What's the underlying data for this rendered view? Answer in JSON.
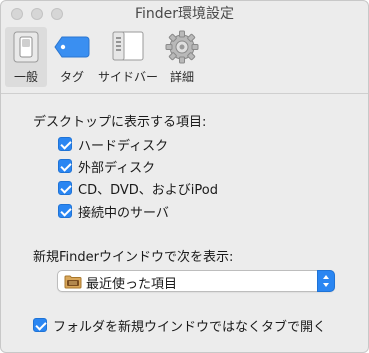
{
  "window": {
    "title": "Finder環境設定"
  },
  "toolbar": {
    "tabs": [
      {
        "label": "一般",
        "icon": "general-switch-icon",
        "selected": true
      },
      {
        "label": "タグ",
        "icon": "tag-icon",
        "selected": false
      },
      {
        "label": "サイドバー",
        "icon": "sidebar-icon",
        "selected": false
      },
      {
        "label": "詳細",
        "icon": "gear-icon",
        "selected": false
      }
    ]
  },
  "desktop_section": {
    "title": "デスクトップに表示する項目:",
    "items": [
      {
        "label": "ハードディスク",
        "checked": true
      },
      {
        "label": "外部ディスク",
        "checked": true
      },
      {
        "label": "CD、DVD、およびiPod",
        "checked": true
      },
      {
        "label": "接続中のサーバ",
        "checked": true
      }
    ]
  },
  "new_window_section": {
    "title": "新規Finderウインドウで次を表示:",
    "selected_value": "最近使った項目",
    "icon": "recents-folder-icon"
  },
  "open_folders_in_tabs": {
    "label": "フォルダを新規ウインドウではなくタブで開く",
    "checked": true
  },
  "colors": {
    "accent": "#2a86f2",
    "tag_blue": "#3a8ff1"
  }
}
